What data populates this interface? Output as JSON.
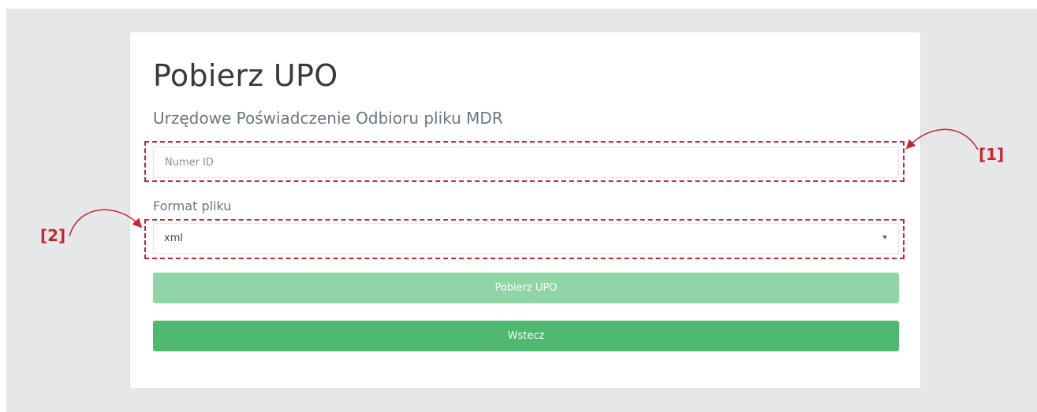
{
  "page": {
    "title": "Pobierz UPO",
    "subtitle": "Urzędowe Poświadczenie Odbioru pliku MDR"
  },
  "form": {
    "id_input": {
      "placeholder": "Numer ID",
      "value": ""
    },
    "format_label": "Format pliku",
    "format_select": {
      "selected": "xml"
    },
    "download_button_label": "Pobierz UPO",
    "back_button_label": "Wstecz"
  },
  "callouts": [
    {
      "label": "[1]"
    },
    {
      "label": "[2]"
    }
  ],
  "colors": {
    "background": "#e6e7e8",
    "primary_button": "#4fb970",
    "primary_button_disabled": "#8fd5a6",
    "callout": "#c8262e"
  },
  "icons": {
    "select_caret": "caret-down-icon"
  }
}
